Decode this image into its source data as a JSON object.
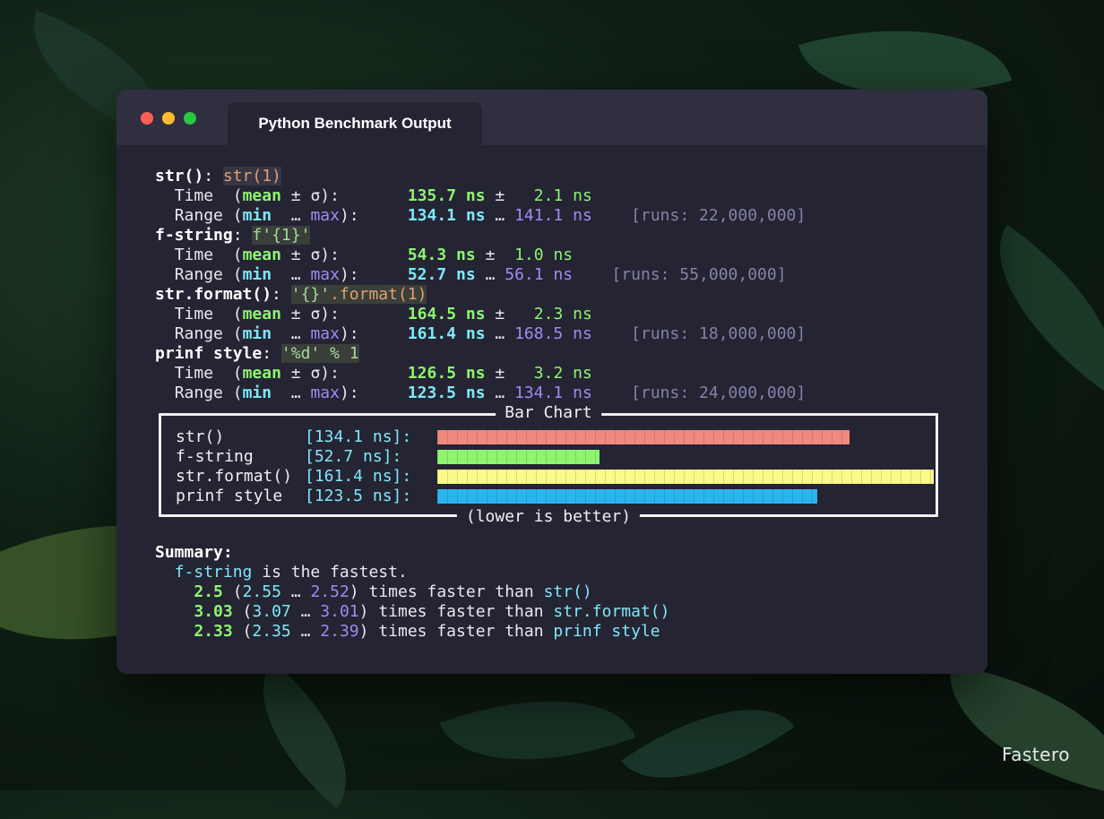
{
  "window": {
    "tab_title": "Python Benchmark Output"
  },
  "benchmarks": [
    {
      "name": "str()",
      "code": "str(1)",
      "mean": "135.7",
      "sigma": "2.1",
      "min": "134.1",
      "max": "141.1",
      "runs": "[runs: 22,000,000]"
    },
    {
      "name": "f-string",
      "code": "f'{1}'",
      "mean": "54.3",
      "sigma": "1.0",
      "min": "52.7",
      "max": "56.1",
      "runs": "[runs: 55,000,000]"
    },
    {
      "name": "str.format()",
      "code_str": "'{}'",
      "code_method": ".format",
      "code_arg": "(1)",
      "mean": "164.5",
      "sigma": "2.3",
      "min": "161.4",
      "max": "168.5",
      "runs": "[runs: 18,000,000]"
    },
    {
      "name": "prinf style",
      "code": "'%d' % 1",
      "mean": "126.5",
      "sigma": "3.2",
      "min": "123.5",
      "max": "134.1",
      "runs": "[runs: 24,000,000]"
    }
  ],
  "labels": {
    "time": "Time",
    "range": "Range",
    "mean": "mean",
    "min": "min",
    "max": "max",
    "pm": "±",
    "sigma": "σ",
    "ellipsis": "…",
    "unit": "ns"
  },
  "chart_data": {
    "type": "bar",
    "title": "Bar Chart",
    "footer": "(lower is better)",
    "categories": [
      "str()",
      "f-string",
      "str.format()",
      "prinf style"
    ],
    "value_labels": [
      "[134.1 ns]:",
      "[52.7 ns]:",
      "[161.4 ns]:",
      "[123.5 ns]:"
    ],
    "values": [
      134.1,
      52.7,
      161.4,
      123.5
    ],
    "colors": [
      "#f08a7e",
      "#8df56f",
      "#fafa88",
      "#2bb5f0"
    ],
    "xlim": [
      0,
      161.4
    ]
  },
  "summary": {
    "heading": "Summary",
    "fastest": "f-string",
    "fastest_text": "is the fastest.",
    "comparisons": [
      {
        "factor": "2.5",
        "lo": "2.55",
        "hi": "2.52",
        "text": "times faster than",
        "target": "str()"
      },
      {
        "factor": "3.03",
        "lo": "3.07",
        "hi": "3.01",
        "text": "times faster than",
        "target": "str.format()"
      },
      {
        "factor": "2.33",
        "lo": "2.35",
        "hi": "2.39",
        "text": "times faster than",
        "target": "prinf style"
      }
    ]
  },
  "watermark": "Fastero"
}
